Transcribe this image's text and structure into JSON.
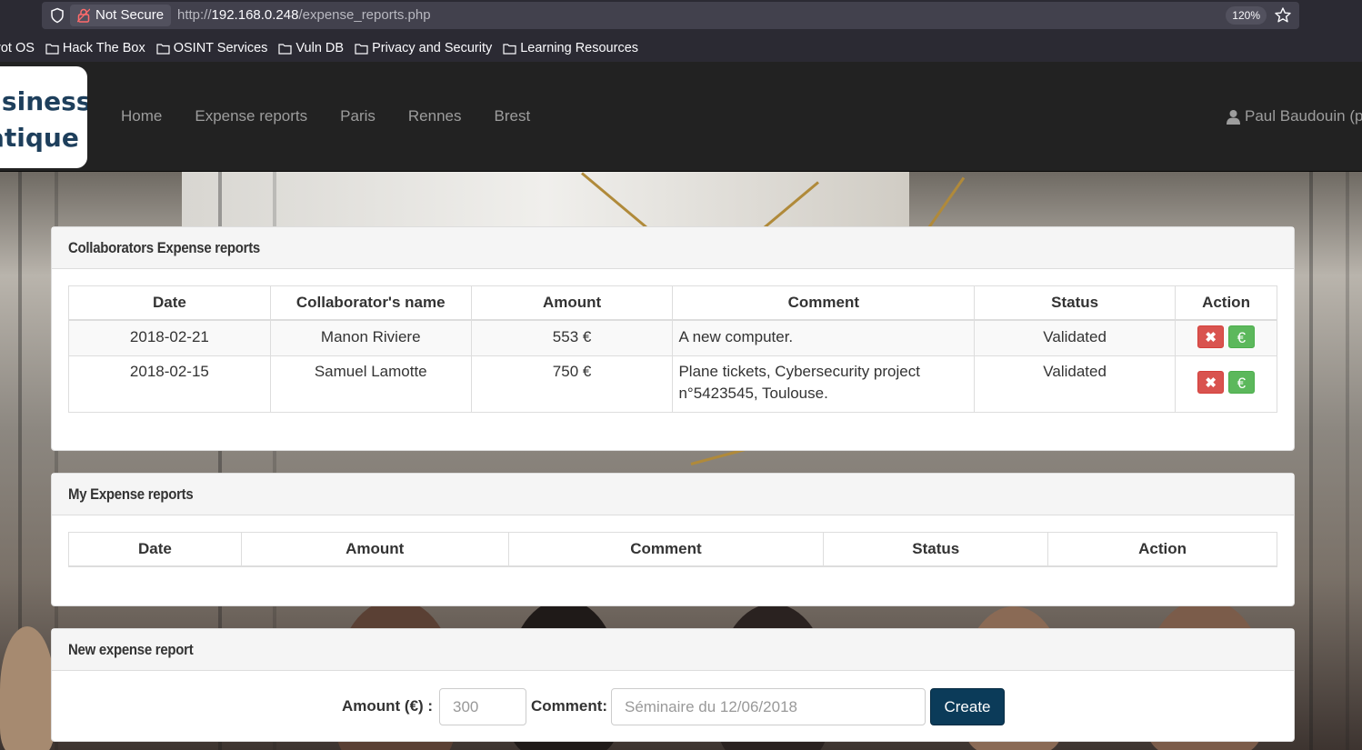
{
  "browser": {
    "security_label": "Not Secure",
    "url_scheme": "http://",
    "url_host": "192.168.0.248",
    "url_path": "/expense_reports.php",
    "zoom": "120%",
    "bookmarks": [
      "rot OS",
      "Hack The Box",
      "OSINT Services",
      "Vuln DB",
      "Privacy and Security",
      "Learning Resources"
    ]
  },
  "site": {
    "logo_line1": "usiness",
    "logo_line2": "atique",
    "nav": [
      "Home",
      "Expense reports",
      "Paris",
      "Rennes",
      "Brest"
    ],
    "user": "Paul Baudouin (p"
  },
  "collab_panel": {
    "title": "Collaborators Expense reports",
    "headers": [
      "Date",
      "Collaborator's name",
      "Amount",
      "Comment",
      "Status",
      "Action"
    ],
    "rows": [
      {
        "date": "2018-02-21",
        "name": "Manon Riviere",
        "amount": "553 €",
        "comment_line1": "A new computer.",
        "comment_line2": "",
        "status": "Validated"
      },
      {
        "date": "2018-02-15",
        "name": "Samuel Lamotte",
        "amount": "750 €",
        "comment_line1": "Plane tickets, Cybersecurity project",
        "comment_line2": "n°5423545, Toulouse.",
        "status": "Validated"
      }
    ],
    "reject_glyph": "✖",
    "pay_glyph": "€"
  },
  "my_panel": {
    "title": "My Expense reports",
    "headers": [
      "Date",
      "Amount",
      "Comment",
      "Status",
      "Action"
    ]
  },
  "new_panel": {
    "title": "New expense report",
    "amount_label": "Amount (€) :",
    "amount_placeholder": "300",
    "comment_label": "Comment:",
    "comment_placeholder": "Séminaire du 12/06/2018",
    "create_label": "Create"
  }
}
